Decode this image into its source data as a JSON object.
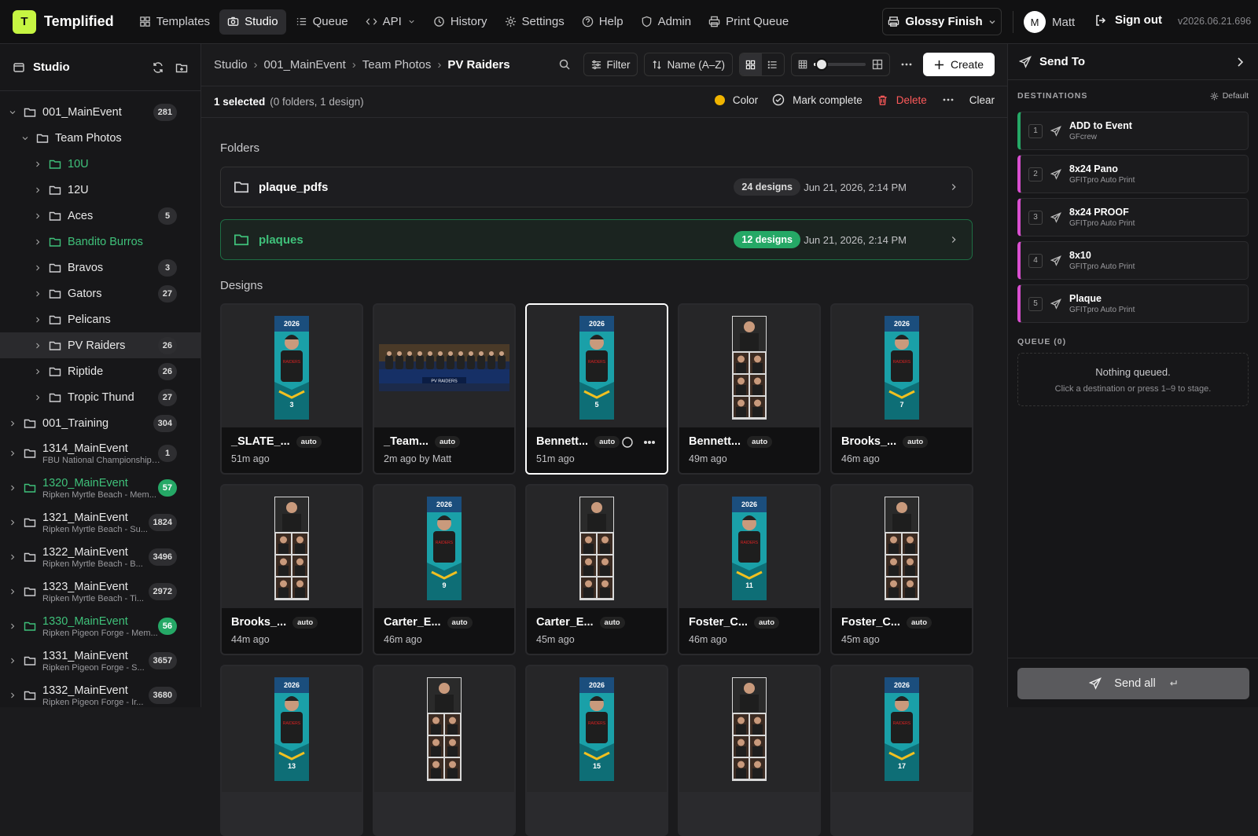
{
  "app": {
    "logo_letter": "T",
    "name": "Templified",
    "accent": "#c6f542"
  },
  "nav": [
    {
      "label": "Templates",
      "icon": "grid-icon"
    },
    {
      "label": "Studio",
      "icon": "camera-icon",
      "active": true
    },
    {
      "label": "Queue",
      "icon": "list-icon"
    },
    {
      "label": "API",
      "icon": "code-icon"
    },
    {
      "label": "History",
      "icon": "history-icon"
    },
    {
      "label": "Settings",
      "icon": "gear-icon"
    },
    {
      "label": "Help",
      "icon": "help-icon"
    },
    {
      "label": "Admin",
      "icon": "shield-icon"
    },
    {
      "label": "Print Queue",
      "icon": "printer-icon"
    }
  ],
  "finish": {
    "label": "Glossy Finish"
  },
  "user": {
    "initial": "M",
    "name": "Matt"
  },
  "signout": {
    "label": "Sign out"
  },
  "version": "v2026.06.21.696",
  "sidebar": {
    "title": "Studio",
    "tree": [
      {
        "name": "001_MainEvent",
        "count": "281",
        "level": 0,
        "open": true
      },
      {
        "name": "Team Photos",
        "count": "",
        "level": 1,
        "open": true
      },
      {
        "name": "10U",
        "count": "",
        "level": 2,
        "green": true
      },
      {
        "name": "12U",
        "count": "",
        "level": 2
      },
      {
        "name": "Aces",
        "count": "5",
        "level": 2
      },
      {
        "name": "Bandito Burros",
        "count": "",
        "level": 2,
        "green": true
      },
      {
        "name": "Bravos",
        "count": "3",
        "level": 2
      },
      {
        "name": "Gators",
        "count": "27",
        "level": 2
      },
      {
        "name": "Pelicans",
        "count": "",
        "level": 2
      },
      {
        "name": "PV Raiders",
        "count": "26",
        "level": 2,
        "selected": true
      },
      {
        "name": "Riptide",
        "count": "26",
        "level": 2
      },
      {
        "name": "Tropic Thund",
        "count": "27",
        "level": 2
      },
      {
        "name": "001_Training",
        "count": "304",
        "level": 0
      },
      {
        "name": "1314_MainEvent",
        "sub": "FBU National Championships ...",
        "count": "1",
        "level": 0
      },
      {
        "name": "1320_MainEvent",
        "sub": "Ripken Myrtle Beach - Mem...",
        "count": "57",
        "level": 0,
        "green": true
      },
      {
        "name": "1321_MainEvent",
        "sub": "Ripken Myrtle Beach - Su...",
        "count": "1824",
        "level": 0
      },
      {
        "name": "1322_MainEvent",
        "sub": "Ripken Myrtle Beach - B...",
        "count": "3496",
        "level": 0
      },
      {
        "name": "1323_MainEvent",
        "sub": "Ripken Myrtle Beach - Ti...",
        "count": "2972",
        "level": 0
      },
      {
        "name": "1330_MainEvent",
        "sub": "Ripken Pigeon Forge - Mem...",
        "count": "56",
        "level": 0,
        "green": true
      },
      {
        "name": "1331_MainEvent",
        "sub": "Ripken Pigeon Forge - S...",
        "count": "3657",
        "level": 0
      },
      {
        "name": "1332_MainEvent",
        "sub": "Ripken Pigeon Forge - Ir...",
        "count": "3680",
        "level": 0
      }
    ]
  },
  "breadcrumb": [
    "Studio",
    "001_MainEvent",
    "Team Photos",
    "PV Raiders"
  ],
  "toolbar": {
    "filter": "Filter",
    "sort": "Name (A–Z)",
    "create": "Create",
    "zoom_level": 0.15
  },
  "selection": {
    "summary": "1 selected",
    "detail": "(0 folders, 1 design)",
    "color": "Color",
    "mark_complete": "Mark complete",
    "delete": "Delete",
    "clear": "Clear"
  },
  "folders_heading": "Folders",
  "folders": [
    {
      "name": "plaque_pdfs",
      "count": "24 designs",
      "date": "Jun 21, 2026, 2:14 PM"
    },
    {
      "name": "plaques",
      "count": "12 designs",
      "date": "Jun 21, 2026, 2:14 PM",
      "green": true
    }
  ],
  "designs_heading": "Designs",
  "designs": [
    {
      "name": "_SLATE_...",
      "tag": "auto",
      "age": "51m ago",
      "kind": "tall"
    },
    {
      "name": "_Team...",
      "tag": "auto",
      "age": "2m ago by Matt",
      "kind": "wide"
    },
    {
      "name": "Bennett...",
      "tag": "auto",
      "age": "51m ago",
      "kind": "tall",
      "selected": true
    },
    {
      "name": "Bennett...",
      "tag": "auto",
      "age": "49m ago",
      "kind": "collage"
    },
    {
      "name": "Brooks_...",
      "tag": "auto",
      "age": "46m ago",
      "kind": "tall"
    },
    {
      "name": "Brooks_...",
      "tag": "auto",
      "age": "44m ago",
      "kind": "collage"
    },
    {
      "name": "Carter_E...",
      "tag": "auto",
      "age": "46m ago",
      "kind": "tall"
    },
    {
      "name": "Carter_E...",
      "tag": "auto",
      "age": "45m ago",
      "kind": "collage"
    },
    {
      "name": "Foster_C...",
      "tag": "auto",
      "age": "46m ago",
      "kind": "tall"
    },
    {
      "name": "Foster_C...",
      "tag": "auto",
      "age": "45m ago",
      "kind": "collage"
    },
    {
      "name": "",
      "tag": "",
      "age": "",
      "kind": "tall",
      "partial": true
    },
    {
      "name": "",
      "tag": "",
      "age": "",
      "kind": "collage",
      "partial": true
    },
    {
      "name": "",
      "tag": "",
      "age": "",
      "kind": "tall",
      "partial": true
    },
    {
      "name": "",
      "tag": "",
      "age": "",
      "kind": "collage",
      "partial": true
    },
    {
      "name": "",
      "tag": "",
      "age": "",
      "kind": "tall",
      "partial": true
    }
  ],
  "send_to": {
    "title": "Send To",
    "destinations_label": "DESTINATIONS",
    "default_label": "Default",
    "destinations": [
      {
        "num": "1",
        "name": "ADD to Event",
        "target": "GFcrew"
      },
      {
        "num": "2",
        "name": "8x24 Pano",
        "target": "GFITpro Auto Print"
      },
      {
        "num": "3",
        "name": "8x24 PROOF",
        "target": "GFITpro Auto Print"
      },
      {
        "num": "4",
        "name": "8x10",
        "target": "GFITpro Auto Print"
      },
      {
        "num": "5",
        "name": "Plaque",
        "target": "GFITpro Auto Print"
      }
    ],
    "queue_label": "QUEUE (0)",
    "queue_empty": "Nothing queued.",
    "queue_hint": "Click a destination or press 1–9 to stage.",
    "send_all": "Send all"
  }
}
